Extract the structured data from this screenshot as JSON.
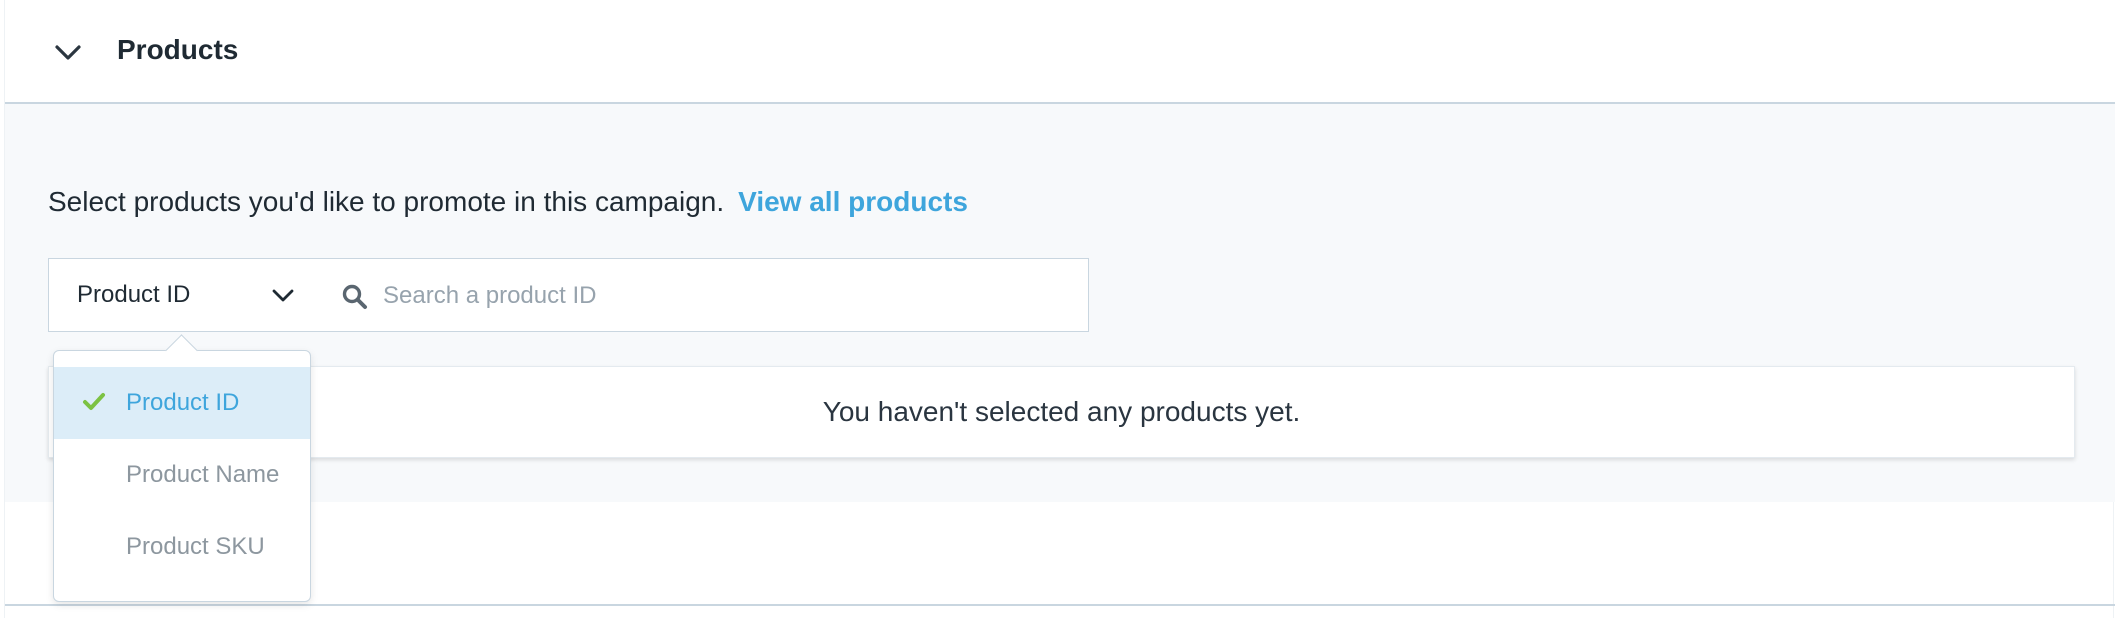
{
  "section": {
    "title": "Products"
  },
  "intro": {
    "text": "Select products you'd like to promote in this campaign.",
    "link": "View all products"
  },
  "selector": {
    "value": "Product ID"
  },
  "search": {
    "placeholder": "Search a product ID",
    "value": ""
  },
  "empty_state": {
    "message": "You haven't selected any products yet."
  },
  "dropdown": {
    "options": [
      {
        "label": "Product ID",
        "selected": true
      },
      {
        "label": "Product Name",
        "selected": false
      },
      {
        "label": "Product SKU",
        "selected": false
      }
    ]
  },
  "colors": {
    "accent": "#3ea5dc",
    "check": "#7cc243",
    "selected_bg": "#dcedf8",
    "body_bg": "#f7f9fb",
    "border": "#c9d6e0"
  },
  "icons": {
    "toggle": "chevron-down-icon",
    "selector": "chevron-down-icon",
    "search": "search-icon",
    "check": "check-icon"
  }
}
